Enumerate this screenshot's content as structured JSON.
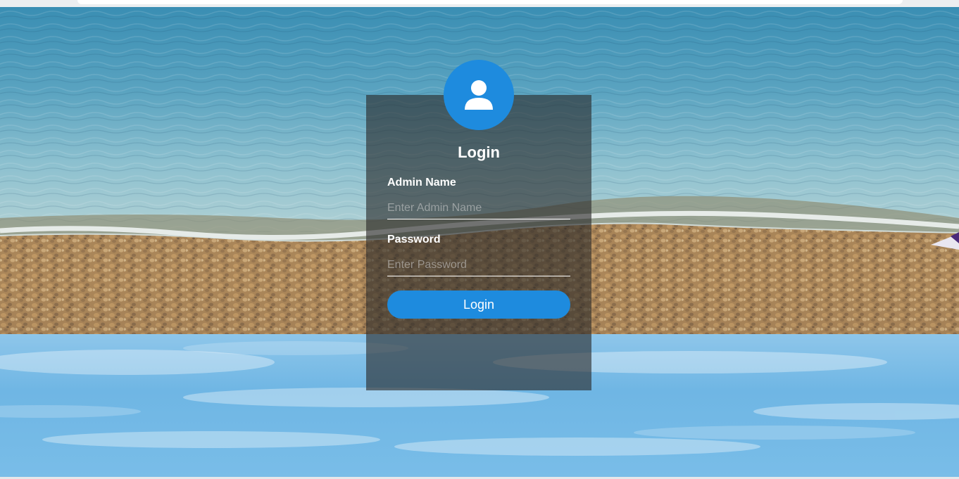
{
  "login": {
    "title": "Login",
    "admin_name": {
      "label": "Admin Name",
      "placeholder": "Enter Admin Name",
      "value": ""
    },
    "password": {
      "label": "Password",
      "placeholder": "Enter Password",
      "value": ""
    },
    "submit_label": "Login",
    "avatar_icon": "user-icon"
  },
  "colors": {
    "accent": "#1e8bde",
    "card_overlay": "rgba(40,40,40,0.62)",
    "text": "#ffffff"
  },
  "background": {
    "upper_image": "beach-photo",
    "lower_image": "sky-photo"
  }
}
